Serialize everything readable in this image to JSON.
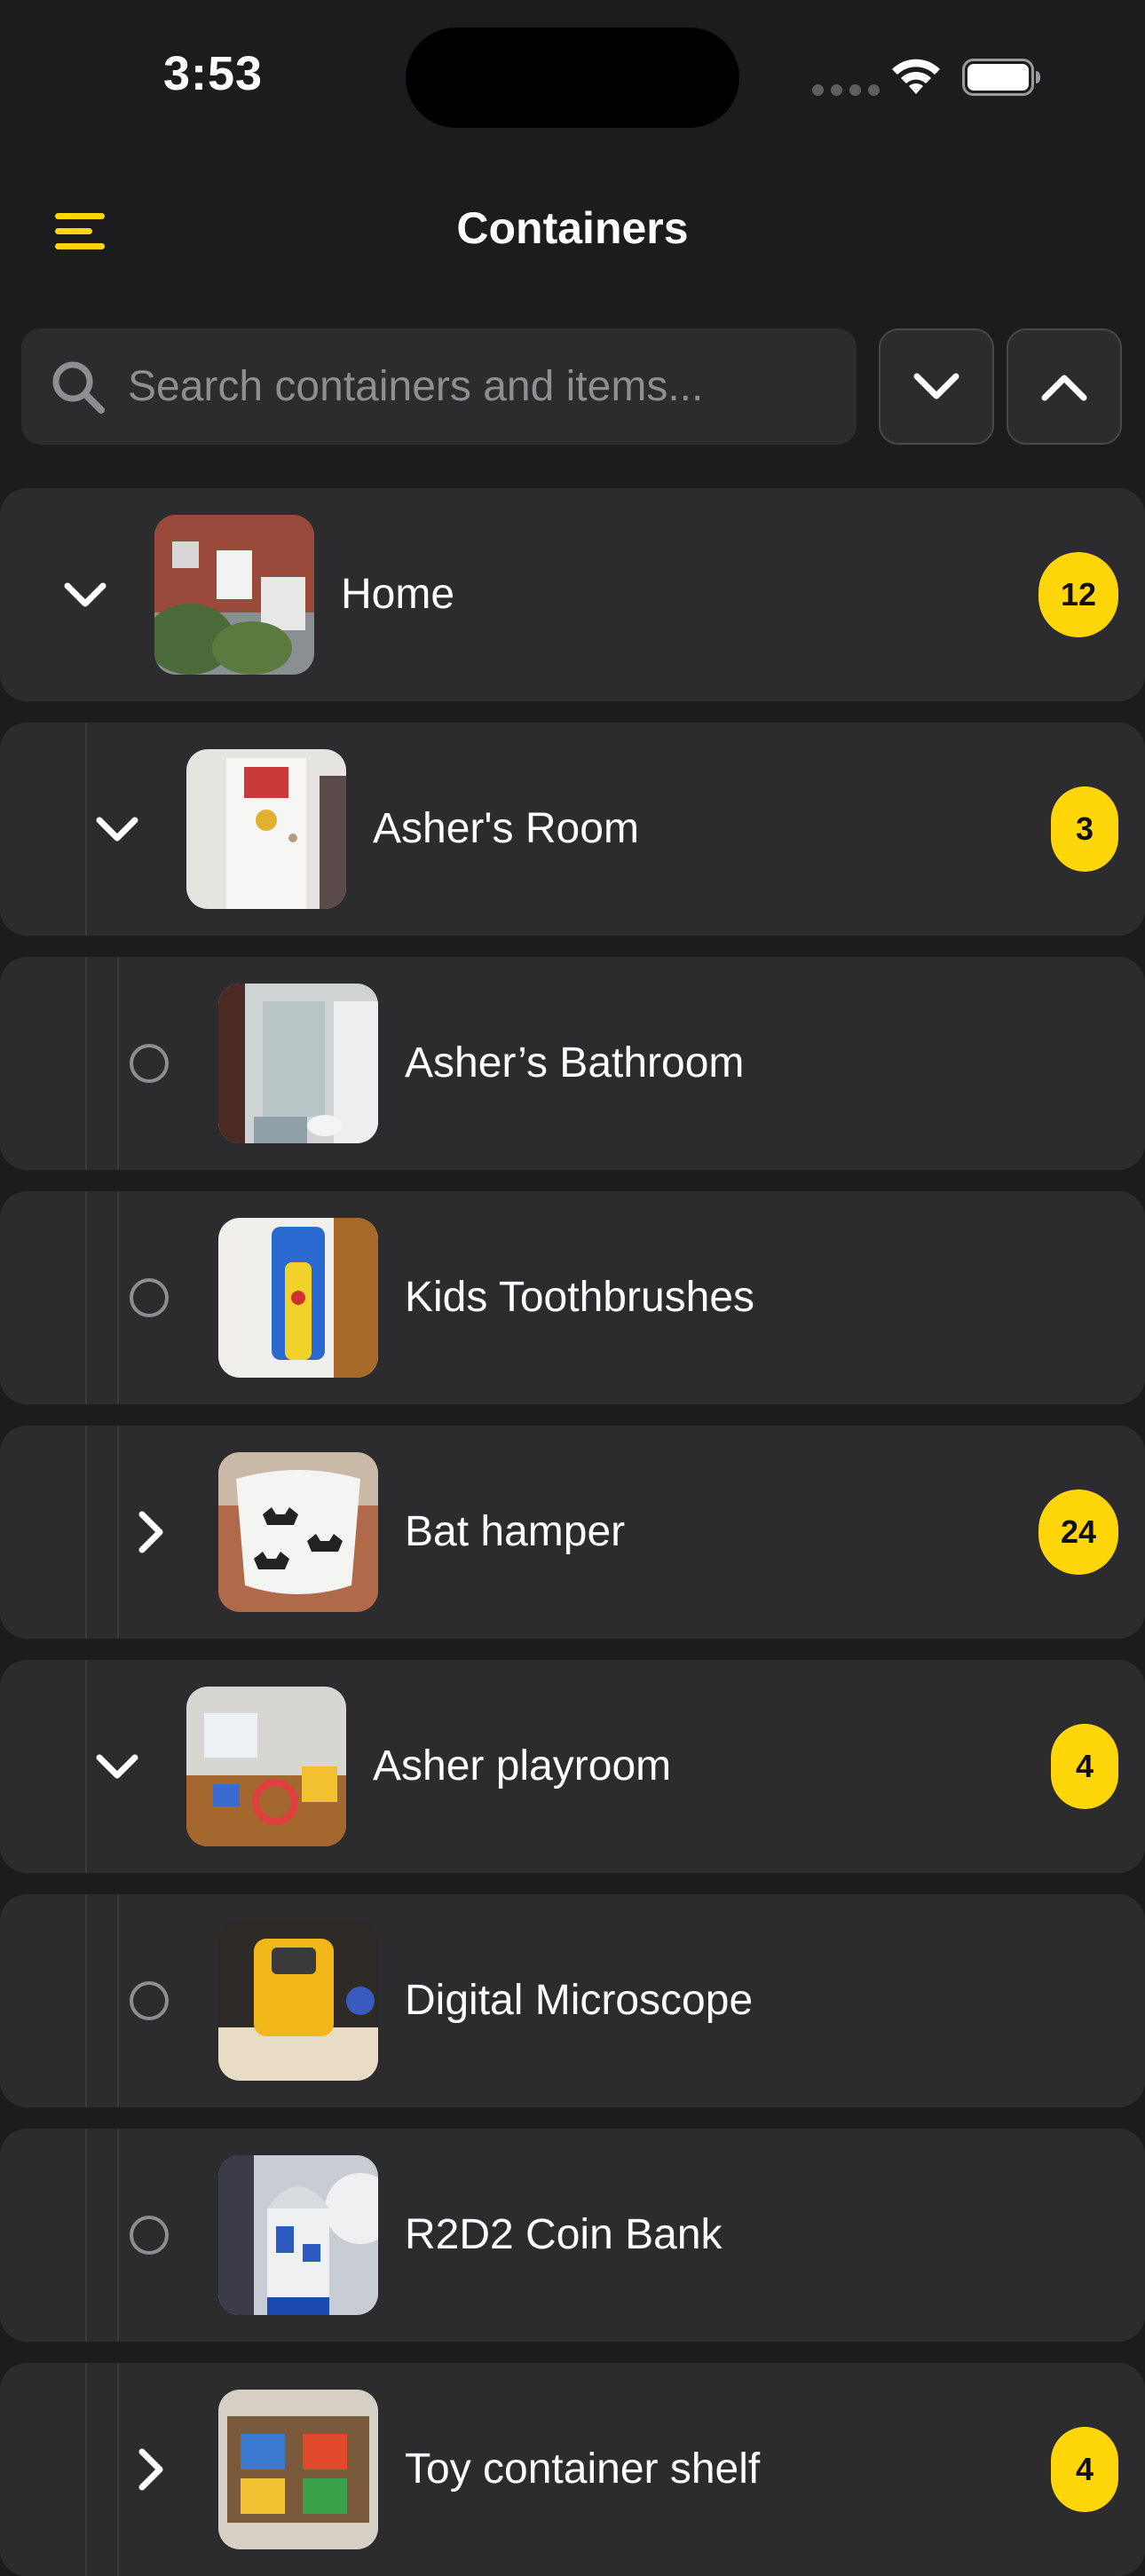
{
  "status_bar": {
    "time": "3:53"
  },
  "nav": {
    "title": "Containers",
    "accent_color": "#ffd60a",
    "menu_icon": "hamburger-menu-icon"
  },
  "search": {
    "placeholder": "Search containers and items...",
    "value": "",
    "collapse_all_icon": "chevron-down-icon",
    "expand_all_icon": "chevron-up-icon"
  },
  "containers": [
    {
      "label": "Home",
      "count": "12",
      "state": "expanded",
      "depth": 0
    },
    {
      "label": "Asher's Room",
      "count": "3",
      "state": "expanded",
      "depth": 1
    },
    {
      "label": "Asher’s Bathroom",
      "count": "",
      "state": "leaf",
      "depth": 2
    },
    {
      "label": "Kids Toothbrushes",
      "count": "",
      "state": "leaf",
      "depth": 2
    },
    {
      "label": "Bat hamper",
      "count": "24",
      "state": "collapsed",
      "depth": 2
    },
    {
      "label": "Asher playroom",
      "count": "4",
      "state": "expanded",
      "depth": 1
    },
    {
      "label": "Digital Microscope",
      "count": "",
      "state": "leaf",
      "depth": 2
    },
    {
      "label": "R2D2 Coin Bank",
      "count": "",
      "state": "leaf",
      "depth": 2
    },
    {
      "label": "Toy container shelf",
      "count": "4",
      "state": "collapsed",
      "depth": 2
    }
  ]
}
